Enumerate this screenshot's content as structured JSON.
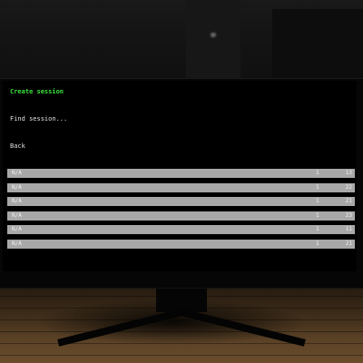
{
  "menu": {
    "create_label": "Create session",
    "find_label": "Find session...",
    "back_label": "Back"
  },
  "sessions": [
    {
      "name": "N/A",
      "players": "1",
      "ping": "13"
    },
    {
      "name": "N/A",
      "players": "1",
      "ping": "22"
    },
    {
      "name": "N/A",
      "players": "1",
      "ping": "21"
    },
    {
      "name": "N/A",
      "players": "1",
      "ping": "23"
    },
    {
      "name": "N/A",
      "players": "1",
      "ping": "11"
    },
    {
      "name": "N/A",
      "players": "1",
      "ping": "21"
    }
  ],
  "colors": {
    "active_menu": "#3be03b",
    "menu_text": "#e0e0e0",
    "row_background": "#a8a8a8",
    "screen": "#000000",
    "floor": "#5a4126"
  }
}
